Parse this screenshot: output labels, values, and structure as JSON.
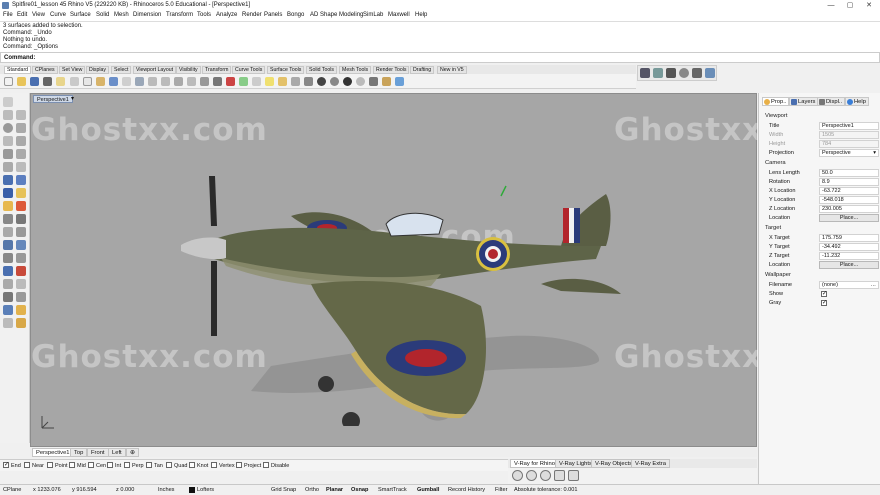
{
  "window": {
    "title": "Spitfire01_lesson 45 Rhino V5 (229220 KB) - Rhinoceros 5.0 Educational - [Perspective1]",
    "min": "—",
    "max": "▢",
    "close": "✕"
  },
  "menu": [
    "File",
    "Edit",
    "View",
    "Curve",
    "Surface",
    "Solid",
    "Mesh",
    "Dimension",
    "Transform",
    "Tools",
    "Analyze",
    "Render",
    "Panels",
    "Bongo",
    "AD Shape Modeling",
    "SimLab",
    "Maxwell",
    "Help"
  ],
  "history": [
    "3 surfaces added to selection.",
    "Command: _Undo",
    "Nothing to undo.",
    "Command: _Options"
  ],
  "command": {
    "label": "Command:",
    "value": ""
  },
  "toolbar_tabs": [
    "Standard",
    "CPlanes",
    "Set View",
    "Display",
    "Select",
    "Viewport Layout",
    "Visibility",
    "Transform",
    "Curve Tools",
    "Surface Tools",
    "Solid Tools",
    "Mesh Tools",
    "Render Tools",
    "Drafting",
    "New in V5"
  ],
  "viewport": {
    "tab": "Perspective1",
    "arrow": "▾",
    "watermark": "Ghostxx.com",
    "center_watermark": "Ghost.com"
  },
  "view_tabs": [
    "Perspective1",
    "Top",
    "Front",
    "Left",
    "⊕"
  ],
  "osnaps": [
    {
      "label": "End",
      "on": true
    },
    {
      "label": "Near",
      "on": false
    },
    {
      "label": "Point",
      "on": false
    },
    {
      "label": "Mid",
      "on": false
    },
    {
      "label": "Cen",
      "on": false
    },
    {
      "label": "Int",
      "on": false
    },
    {
      "label": "Perp",
      "on": false
    },
    {
      "label": "Tan",
      "on": false
    },
    {
      "label": "Quad",
      "on": false
    },
    {
      "label": "Knot",
      "on": false
    },
    {
      "label": "Vertex",
      "on": false
    },
    {
      "label": "Project",
      "on": false
    },
    {
      "label": "Disable",
      "on": false
    }
  ],
  "vray_tabs": [
    "V-Ray for Rhino",
    "V-Ray Lights",
    "V-Ray Objects",
    "V-Ray Extra"
  ],
  "status": {
    "cplane": "CPlane",
    "x": "x 1233.076",
    "y": "y 916.594",
    "z": "z 0.000",
    "units": "Inches",
    "layer": "Lofters",
    "grid_snap": "Grid Snap",
    "ortho": "Ortho",
    "planar": "Planar",
    "osnap": "Osnap",
    "smarttrack": "SmartTrack",
    "gumball": "Gumball",
    "record_history": "Record History",
    "filter": "Filter",
    "tolerance": "Absolute tolerance: 0.001"
  },
  "panel": {
    "tabs": [
      "Prop..",
      "Layers",
      "Displ..",
      "Help"
    ],
    "viewport_heading": "Viewport",
    "title_label": "Title",
    "title_value": "Perspective1",
    "width_label": "Width",
    "width_value": "1505",
    "height_label": "Height",
    "height_value": "784",
    "projection_label": "Projection",
    "projection_value": "Perspective",
    "camera_heading": "Camera",
    "lens_label": "Lens Length",
    "lens_value": "50.0",
    "rotation_label": "Rotation",
    "rotation_value": "8.9",
    "xloc_label": "X Location",
    "xloc_value": "-63.722",
    "yloc_label": "Y Location",
    "yloc_value": "-548.018",
    "zloc_label": "Z Location",
    "zloc_value": "230.005",
    "loc_label": "Location",
    "place_label": "Place...",
    "target_heading": "Target",
    "xt_label": "X Target",
    "xt_value": "175.759",
    "yt_label": "Y Target",
    "yt_value": "-34.492",
    "zt_label": "Z Target",
    "zt_value": "-11.232",
    "tloc_label": "Location",
    "tplace_label": "Place...",
    "wallpaper_heading": "Wallpaper",
    "filename_label": "Filename",
    "filename_value": "(none)",
    "show_label": "Show",
    "gray_label": "Gray"
  },
  "colors": {
    "viewport_bg": "#a6a6a6",
    "camo_green": "#5e6448",
    "roundel_blue": "#2b3b7a",
    "roundel_red": "#b2252c"
  }
}
